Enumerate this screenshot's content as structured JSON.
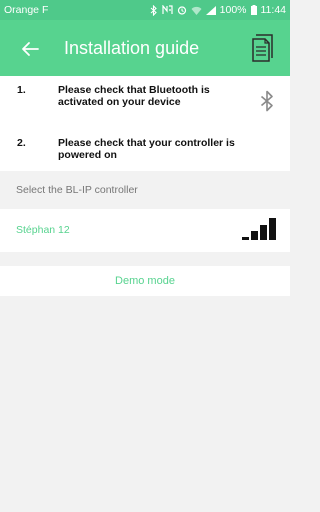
{
  "status_bar": {
    "carrier": "Orange F",
    "battery": "100%",
    "time": "11:44"
  },
  "app_bar": {
    "title": "Installation guide",
    "back_icon": "arrow-left-icon",
    "action_icon": "document-copy-icon"
  },
  "steps": [
    {
      "number": "1.",
      "text": "Please check that Bluetooth is activated on your device",
      "icon": "bluetooth-icon"
    },
    {
      "number": "2.",
      "text": "Please check that your controller is powered on"
    }
  ],
  "controllers": {
    "header": "Select the BL-IP controller",
    "items": [
      {
        "name": "Stéphan 12",
        "signal_bars": 4,
        "signal_max": 4
      }
    ]
  },
  "demo": {
    "label": "Demo mode"
  },
  "colors": {
    "accent": "#57d38f",
    "status_bar": "#4fc98a",
    "background": "#f2f2f2"
  }
}
